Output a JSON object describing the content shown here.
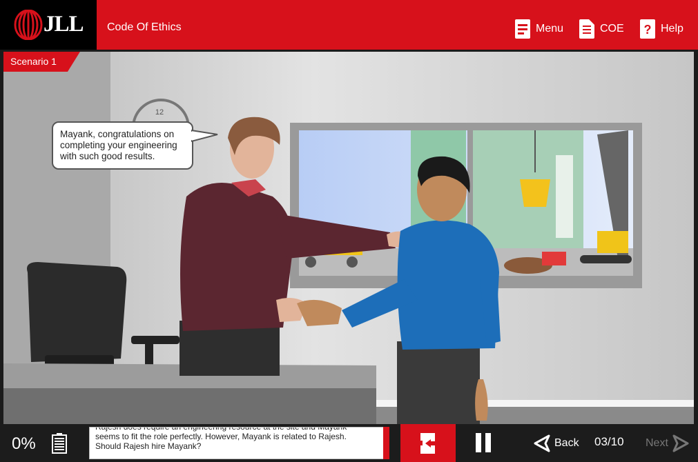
{
  "header": {
    "logo_text": "JLL",
    "course_title": "Code Of Ethics",
    "menu_label": "Menu",
    "coe_label": "COE",
    "help_label": "Help"
  },
  "stage": {
    "scenario_label": "Scenario 1",
    "speech_bubble": "Mayank, congratulations on completing your engineering with such good results.",
    "clock_number": "12"
  },
  "footer": {
    "progress_text": "0%",
    "progress": 0,
    "caption": "Rajesh does require an engineering resource at the site and Mayank seems to fit the role perfectly. However, Mayank is related to Rajesh. Should Rajesh hire Mayank?",
    "back_label": "Back",
    "page_counter": "03/10",
    "next_label": "Next"
  },
  "colors": {
    "brand_red": "#d7111b",
    "footer_bg": "#1c1c1c",
    "disabled": "#777777"
  }
}
